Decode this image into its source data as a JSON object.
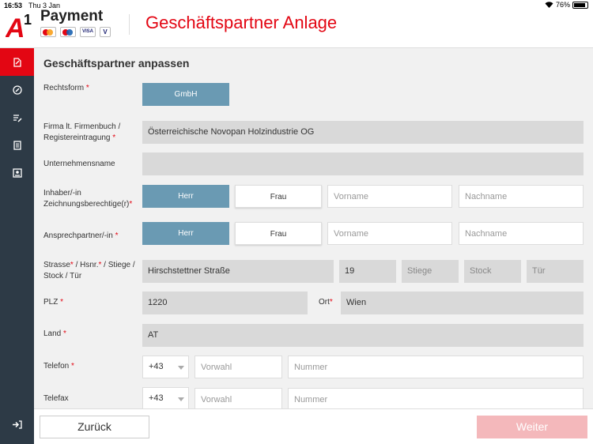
{
  "status": {
    "time": "16:53",
    "date": "Thu 3 Jan",
    "battery": "76%",
    "battery_level": 0.76
  },
  "header": {
    "brand": "Payment",
    "logo_text": "A1",
    "cards": [
      "mastercard",
      "maestro",
      "VISA",
      "V PAY"
    ],
    "title": "Geschäftspartner Anlage"
  },
  "sidebar": {
    "items": [
      {
        "icon": "edit-document-icon",
        "active": true
      },
      {
        "icon": "compass-icon",
        "active": false
      },
      {
        "icon": "list-edit-icon",
        "active": false
      },
      {
        "icon": "book-icon",
        "active": false
      },
      {
        "icon": "inbox-user-icon",
        "active": false
      }
    ],
    "logout_icon": "logout-icon"
  },
  "form": {
    "section_title": "Geschäftspartner anpassen",
    "rechtsform": {
      "label": "Rechtsform",
      "value": "GmbH"
    },
    "firma": {
      "label_line1": "Firma lt. Firmenbuch /",
      "label_line2": "Registereintragung",
      "value": "Österreichische Novopan Holzindustrie OG"
    },
    "unternehmensname": {
      "label": "Unternehmensname",
      "value": ""
    },
    "inhaber": {
      "label_line1": "Inhaber/-in",
      "label_line2": "Zeichnungsberechtige(r)",
      "herr": "Herr",
      "frau": "Frau",
      "vorname_placeholder": "Vorname",
      "nachname_placeholder": "Nachname"
    },
    "ansprech": {
      "label": "Ansprechpartner/-in",
      "herr": "Herr",
      "frau": "Frau",
      "vorname_placeholder": "Vorname",
      "nachname_placeholder": "Nachname"
    },
    "strasse": {
      "label_p1": "Strasse",
      "label_p2": " / Hsnr.",
      "label_p3": " / Stiege /",
      "label_line2": "Stock / Tür",
      "street": "Hirschstettner Straße",
      "hsnr": "19",
      "stiege_placeholder": "Stiege",
      "stock_placeholder": "Stock",
      "tuer_placeholder": "Tür"
    },
    "plz": {
      "label": "PLZ",
      "value": "1220",
      "ort_label": "Ort",
      "ort_value": "Wien"
    },
    "land": {
      "label": "Land",
      "value": "AT"
    },
    "telefon": {
      "label": "Telefon",
      "prefix": "+43",
      "vorwahl_placeholder": "Vorwahl",
      "nummer_placeholder": "Nummer"
    },
    "telefax": {
      "label": "Telefax",
      "prefix": "+43",
      "vorwahl_placeholder": "Vorwahl",
      "nummer_placeholder": "Nummer"
    }
  },
  "footer": {
    "back": "Zurück",
    "next": "Weiter"
  },
  "colors": {
    "accent": "#e30613",
    "sidebar": "#2d3a46",
    "toggle_on": "#6a9ab3",
    "next_disabled": "#f4b8bb"
  }
}
